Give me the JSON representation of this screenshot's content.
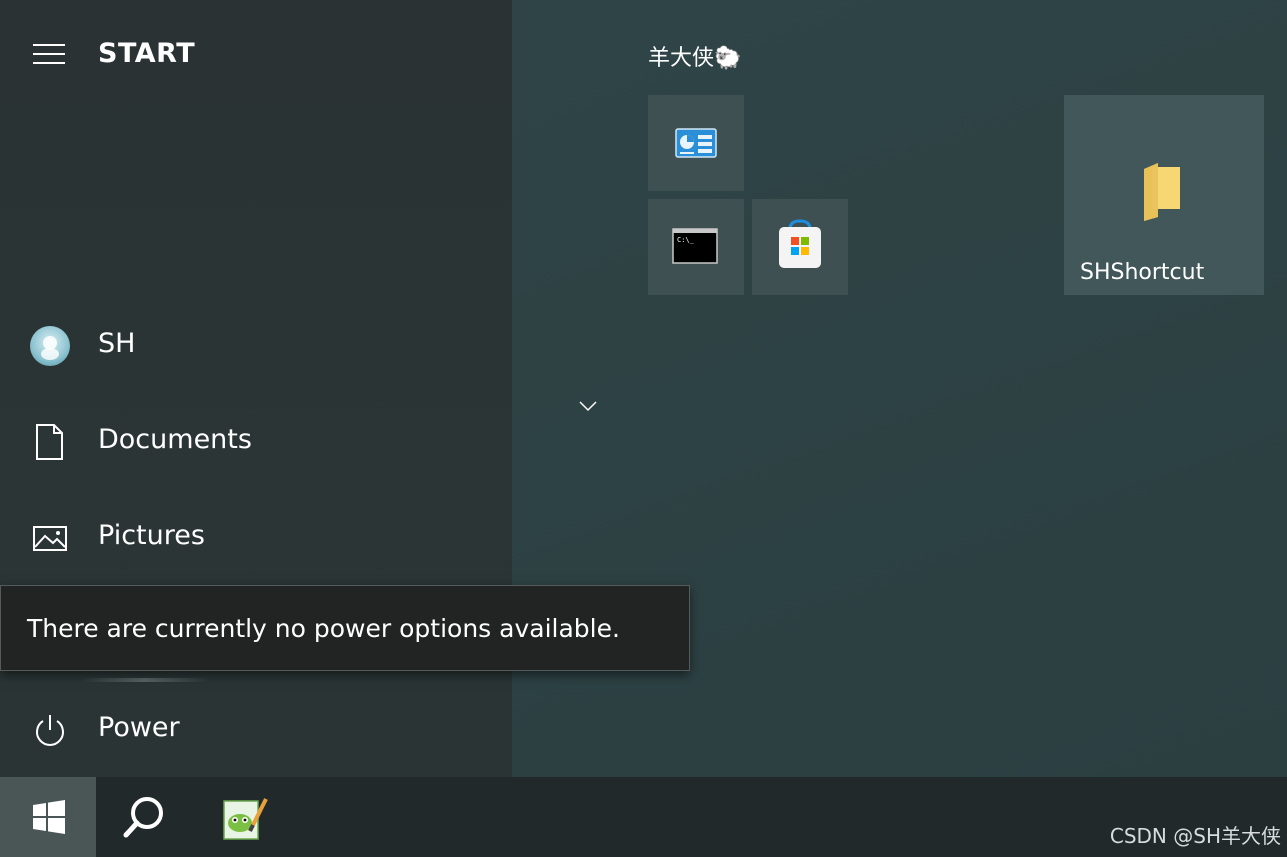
{
  "start_menu": {
    "title": "START",
    "nav_items": [
      {
        "label": "SH",
        "icon": "user-avatar"
      },
      {
        "label": "Documents",
        "icon": "document-icon"
      },
      {
        "label": "Pictures",
        "icon": "pictures-icon"
      },
      {
        "label": "Power",
        "icon": "power-icon"
      }
    ],
    "tooltip": "There are currently no power options available."
  },
  "tiles": {
    "group_title": "羊大侠🐑",
    "items": [
      {
        "icon": "control-panel-icon",
        "label": ""
      },
      {
        "icon": "command-prompt-icon",
        "label": ""
      },
      {
        "icon": "microsoft-store-icon",
        "label": ""
      },
      {
        "icon": "folder-icon",
        "label": "SHShortcut"
      }
    ]
  },
  "taskbar": {
    "items": [
      "windows-start-icon",
      "search-icon",
      "notepad-plus-plus-icon"
    ]
  },
  "watermark": "CSDN @SH羊大侠",
  "colors": {
    "left_pane": "#2a3233",
    "right_pane": "#2f4446",
    "tile": "#3e5052",
    "taskbar": "#21292b",
    "tooltip": "#222424"
  }
}
